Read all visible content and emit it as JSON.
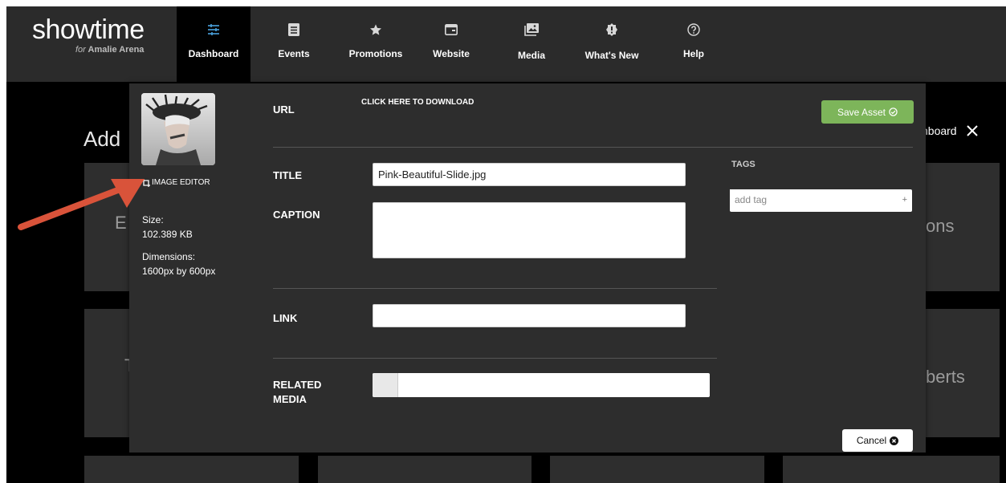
{
  "brand": {
    "name": "showtime",
    "sub_prefix": "for",
    "sub_venue": "Amalie Arena"
  },
  "nav": [
    {
      "label": "Dashboard",
      "icon": "sliders-icon",
      "active": true
    },
    {
      "label": "Events",
      "icon": "list-icon"
    },
    {
      "label": "Promotions",
      "icon": "star-icon"
    },
    {
      "label": "Website",
      "icon": "window-icon"
    },
    {
      "label": "Media",
      "icon": "images-icon"
    },
    {
      "label": "What's New",
      "icon": "badge-icon"
    },
    {
      "label": "Help",
      "icon": "question-icon"
    }
  ],
  "background": {
    "title": "Add",
    "dashboard_link": "hboard",
    "tile_texts": [
      "E",
      "ons",
      "T",
      "berts"
    ]
  },
  "modal": {
    "image_editor": "IMAGE EDITOR",
    "size_label": "Size:",
    "size_value": "102.389 KB",
    "dimensions_label": "Dimensions:",
    "dimensions_value": "1600px by 600px",
    "url_label": "URL",
    "download_link": "CLICK HERE TO DOWNLOAD",
    "save_button": "Save Asset",
    "title_label": "TITLE",
    "title_value": "Pink-Beautiful-Slide.jpg",
    "caption_label": "CAPTION",
    "caption_value": "",
    "tags_label": "TAGS",
    "tags_placeholder": "add tag",
    "tags_plus": "+",
    "link_label": "LINK",
    "link_value": "",
    "related_label_line1": "RELATED",
    "related_label_line2": "MEDIA",
    "cancel_button": "Cancel"
  },
  "colors": {
    "topbar": "#2b2b2b",
    "modal": "#2d2d2d",
    "save_green": "#7db55a",
    "nav_active_icon": "#4aa3df",
    "annotation_arrow": "#d9533a"
  }
}
